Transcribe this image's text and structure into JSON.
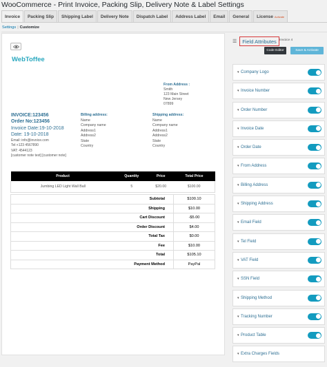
{
  "page_title": "WooCommerce - Print Invoice, Packing Slip, Delivery Note & Label Settings",
  "tabs": [
    {
      "label": "Invoice",
      "active": true
    },
    {
      "label": "Packing Slip"
    },
    {
      "label": "Shipping Label"
    },
    {
      "label": "Delivery Note"
    },
    {
      "label": "Dispatch Label"
    },
    {
      "label": "Address Label"
    },
    {
      "label": "Email"
    },
    {
      "label": "General"
    },
    {
      "label": "License",
      "badge": "Activate"
    }
  ],
  "subnav": {
    "settings": "Settings",
    "separator": "|",
    "customize": "Customize"
  },
  "preview": {
    "logo": "WebToffee",
    "from_address": {
      "label": "From Address :",
      "lines": [
        "Smith",
        "123 Main Street",
        "New Jersey",
        "07899"
      ]
    },
    "invoice": {
      "number": "INVOICE:123456",
      "order_no": "Order No:123456",
      "invoice_date": "Invoice Date:19-10-2018",
      "date": "Date: 19-10-2018",
      "email": "Email: info@invoice.com",
      "tel": "Tel:+123 4567890",
      "vat": "VAT: 4544123",
      "customer_note": "[customer note text] [customer note]"
    },
    "billing": {
      "label": "Billing address:",
      "lines": [
        "Name",
        "Company name",
        "Address1",
        "Address2",
        "State",
        "Country"
      ]
    },
    "shipping": {
      "label": "Shipping address:",
      "lines": [
        "Name",
        "Company name",
        "Address1",
        "Address2",
        "State",
        "Country"
      ]
    },
    "table": {
      "headers": [
        "Product",
        "Quantity",
        "Price",
        "Total Price"
      ],
      "rows": [
        [
          "Jumbing LED Light Wall Ball",
          "5",
          "$20.00",
          "$100.00"
        ]
      ]
    },
    "summary": [
      {
        "label": "Subtotal",
        "value": "$100.10"
      },
      {
        "label": "Shipping",
        "value": "$10.00"
      },
      {
        "label": "Cart Discount",
        "value": "-$5.00"
      },
      {
        "label": "Order Discount",
        "value": "$4.00"
      },
      {
        "label": "Total Tax",
        "value": "$0.00"
      },
      {
        "label": "Fee",
        "value": "$10.00"
      },
      {
        "label": "Total",
        "value": "$105.10"
      },
      {
        "label": "Payment Method",
        "value": "PayPal"
      }
    ]
  },
  "right_panel": {
    "title": "Field Attributes",
    "invoice_label": "Invoice 4",
    "code_editor": "Code Editor",
    "save_activate": "Save & Activate",
    "attributes": [
      {
        "label": "Company Logo",
        "enabled": true
      },
      {
        "label": "Invoice Number",
        "enabled": true
      },
      {
        "label": "Order Number",
        "enabled": true
      },
      {
        "label": "Invoice Date",
        "enabled": true
      },
      {
        "label": "Order Date",
        "enabled": true
      },
      {
        "label": "From Address",
        "enabled": true
      },
      {
        "label": "Billing Address",
        "enabled": true
      },
      {
        "label": "Shipping Address",
        "enabled": true
      },
      {
        "label": "Email Field",
        "enabled": true
      },
      {
        "label": "Tel Field",
        "enabled": true
      },
      {
        "label": "VAT Field",
        "enabled": true
      },
      {
        "label": "SSN Field",
        "enabled": true
      },
      {
        "label": "Shipping Method",
        "enabled": true
      },
      {
        "label": "Tracking Number",
        "enabled": true
      },
      {
        "label": "Product Table",
        "enabled": true
      },
      {
        "label": "Extra Charges Fields",
        "enabled": false
      }
    ]
  },
  "colors": {
    "accent": "#139bbf",
    "link": "#0073aa",
    "highlight": "#d63638",
    "label_blue": "#2d6f93"
  }
}
